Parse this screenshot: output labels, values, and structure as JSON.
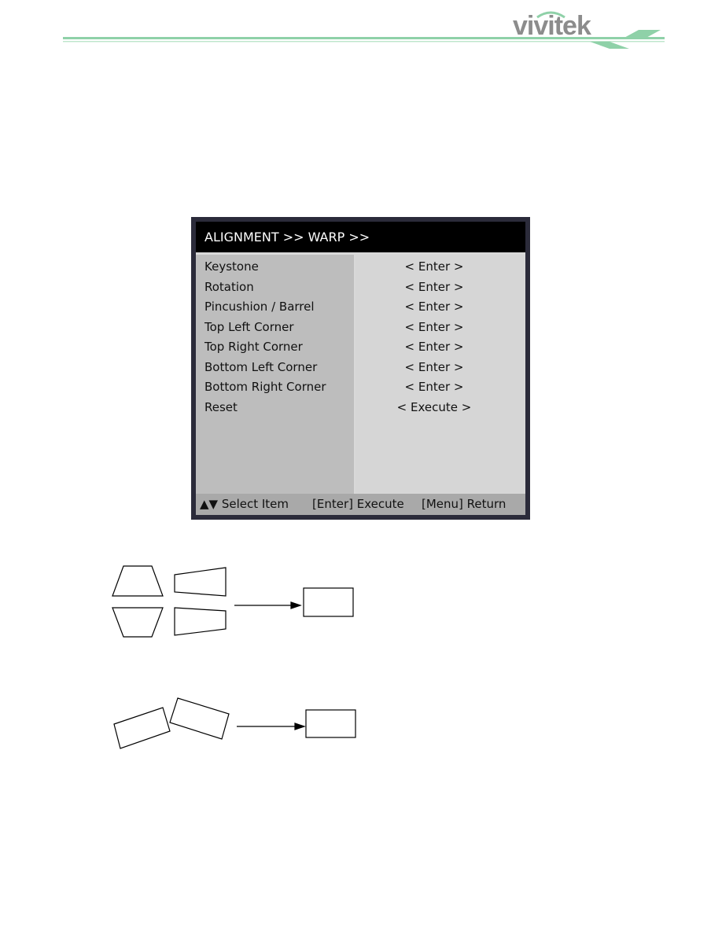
{
  "header": {
    "logo_text": "vivitek",
    "accent": "#8fd1a8"
  },
  "osd": {
    "title": "ALIGNMENT >> WARP >>",
    "items": [
      {
        "label": "Keystone",
        "value": "< Enter >"
      },
      {
        "label": "Rotation",
        "value": "< Enter >"
      },
      {
        "label": "Pincushion / Barrel",
        "value": "< Enter >"
      },
      {
        "label": "Top Left Corner",
        "value": "< Enter >"
      },
      {
        "label": "Top Right Corner",
        "value": "< Enter >"
      },
      {
        "label": "Bottom Left Corner",
        "value": "< Enter >"
      },
      {
        "label": "Bottom Right Corner",
        "value": "< Enter >"
      },
      {
        "label": "Reset",
        "value": "< Execute >"
      }
    ],
    "footer": {
      "select": "▲▼ Select Item",
      "execute": "[Enter] Execute",
      "return": "[Menu] Return"
    }
  }
}
